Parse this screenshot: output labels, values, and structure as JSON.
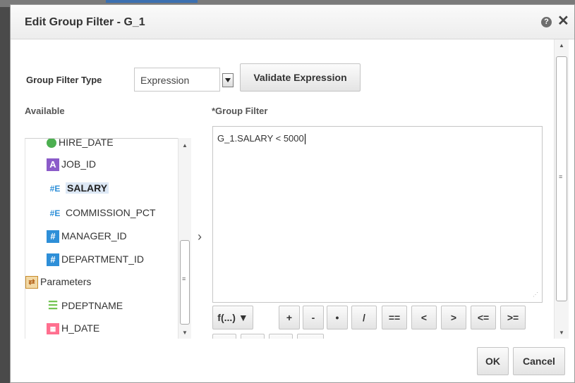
{
  "dialog": {
    "title": "Edit Group Filter - G_1",
    "help_icon": "?",
    "close_icon": "✕"
  },
  "filter_type": {
    "label": "Group Filter Type",
    "selected": "Expression",
    "validate_label": "Validate Expression"
  },
  "available": {
    "label": "Available",
    "items": [
      {
        "label": "HIRE_DATE",
        "icon": "date-field-icon"
      },
      {
        "label": "JOB_ID",
        "icon": "text-field-icon",
        "icon_text": "A"
      },
      {
        "label": "SALARY",
        "icon": "number-field-icon",
        "icon_text": "#E",
        "selected": true
      },
      {
        "label": "COMMISSION_PCT",
        "icon": "number-field-icon",
        "icon_text": "#E"
      },
      {
        "label": "MANAGER_ID",
        "icon": "integer-field-icon",
        "icon_text": "#"
      },
      {
        "label": "DEPARTMENT_ID",
        "icon": "integer-field-icon",
        "icon_text": "#"
      },
      {
        "label": "Parameters",
        "icon": "parameters-folder-icon"
      },
      {
        "label": "PDEPTNAME",
        "icon": "list-parameter-icon"
      },
      {
        "label": "H_DATE",
        "icon": "calendar-parameter-icon"
      }
    ]
  },
  "group_filter": {
    "label": "*Group Filter",
    "expression": "G_1.SALARY < 5000"
  },
  "operators": {
    "row1": [
      "f(...) ▼",
      "+",
      "-",
      "•",
      "/",
      "==",
      "<",
      ">",
      "<=",
      ">="
    ],
    "row2": [
      "<>",
      "(",
      ")",
      "||"
    ]
  },
  "footer": {
    "ok_label": "OK",
    "cancel_label": "Cancel"
  },
  "colors": {
    "accent": "#2e8fd8",
    "selection": "#dde8f5"
  }
}
